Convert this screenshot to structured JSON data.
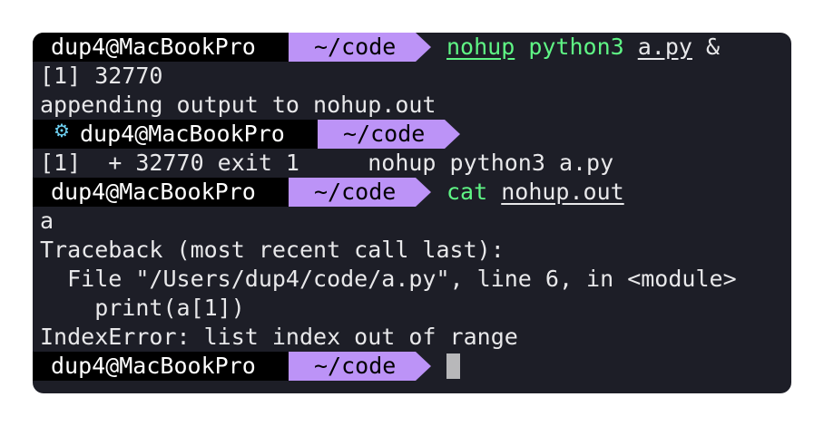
{
  "prompt": {
    "host": "dup4@MacBookPro",
    "dir": "~/code"
  },
  "lines": {
    "l1": {
      "cmd": "nohup",
      "arg1": "python3",
      "arg2": "a.py",
      "arg3": "&"
    },
    "l2": "[1] 32770",
    "l3": "appending output to nohup.out",
    "l4_icon": "gear-icon",
    "l5": "[1]  + 32770 exit 1     nohup python3 a.py",
    "l6": {
      "cmd": "cat",
      "arg1": "nohup.out"
    },
    "l7": "a",
    "l8": "Traceback (most recent call last):",
    "l9": "  File \"/Users/dup4/code/a.py\", line 6, in <module>",
    "l10": "    print(a[1])",
    "l11": "IndexError: list index out of range"
  },
  "colors": {
    "background": "#1d1e27",
    "host_bg": "#000000",
    "dir_bg": "#bc93f7",
    "command_green": "#5ff585",
    "gear_cyan": "#6fd3f5"
  }
}
